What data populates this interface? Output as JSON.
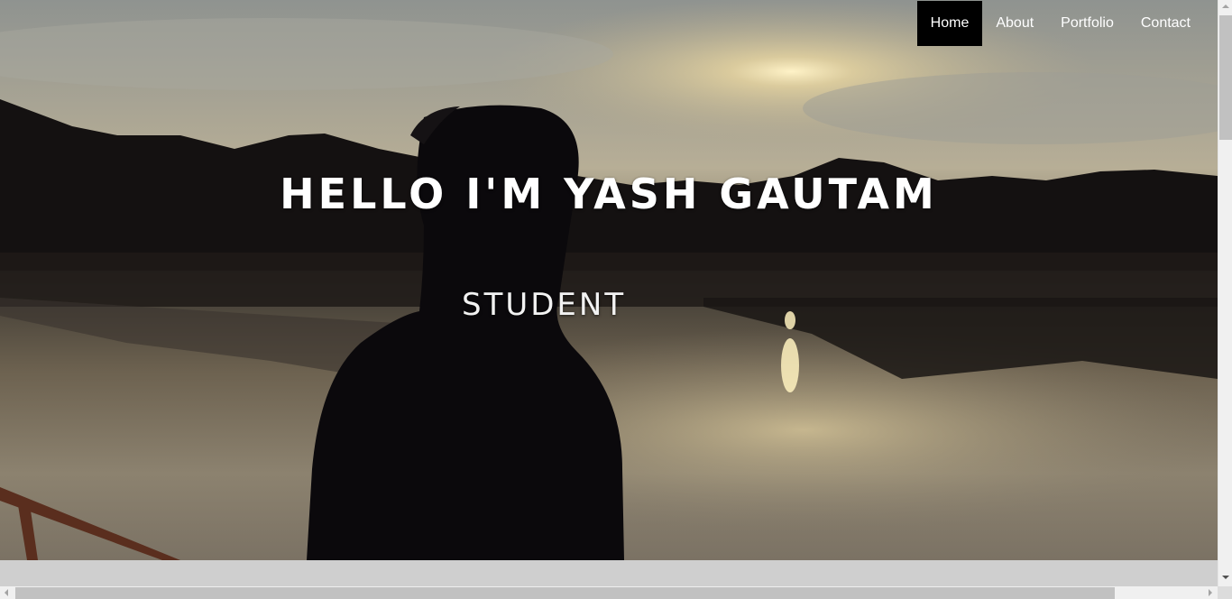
{
  "nav": {
    "items": [
      {
        "label": "Home",
        "active": true
      },
      {
        "label": "About",
        "active": false
      },
      {
        "label": "Portfolio",
        "active": false
      },
      {
        "label": "Contact",
        "active": false
      }
    ]
  },
  "hero": {
    "title": "HELLO I'M YASH GAUTAM",
    "subtitle": "STUDENT",
    "background_description_icon": "sunset-lake-photo"
  },
  "colors": {
    "nav_active_bg": "#000000",
    "text": "#ffffff"
  }
}
